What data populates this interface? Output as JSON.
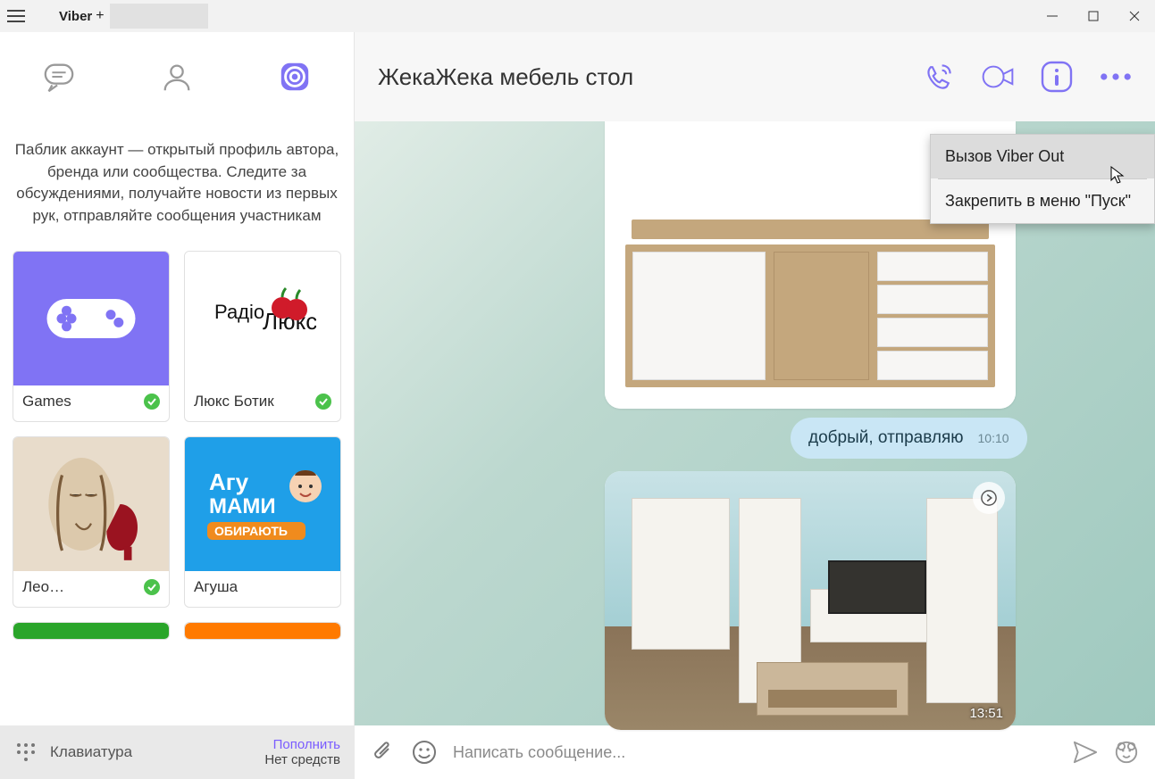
{
  "app": {
    "title": "Viber",
    "plus": "+"
  },
  "sidebar": {
    "desc": "Паблик аккаунт — открытый профиль автора, бренда или сообщества. Следите за обсуждениями, получайте новости из первых рук, отправляйте сообщения участникам",
    "cards": [
      {
        "name": "Games",
        "verified": true,
        "color": "#8073f4"
      },
      {
        "name": "Люкс Ботик",
        "verified": true,
        "color": "#ffffff"
      },
      {
        "name": "Лео…",
        "verified": true,
        "color": "#e8dccb"
      },
      {
        "name": "Агуша",
        "verified": false,
        "color": "#1f9fe8"
      }
    ],
    "stubs": [
      "#2aa52a",
      "#ff7a00"
    ]
  },
  "conv": {
    "title": "ЖекаЖека мебель стол",
    "text_msg": "добрый, отправляю",
    "text_time": "10:10",
    "img2_time": "13:51"
  },
  "context": {
    "item1": "Вызов Viber Out",
    "item2": "Закрепить в меню \"Пуск\""
  },
  "bottom": {
    "keyboard": "Клавиатура",
    "topup": "Пополнить",
    "nofunds": "Нет средств",
    "placeholder": "Написать сообщение..."
  }
}
